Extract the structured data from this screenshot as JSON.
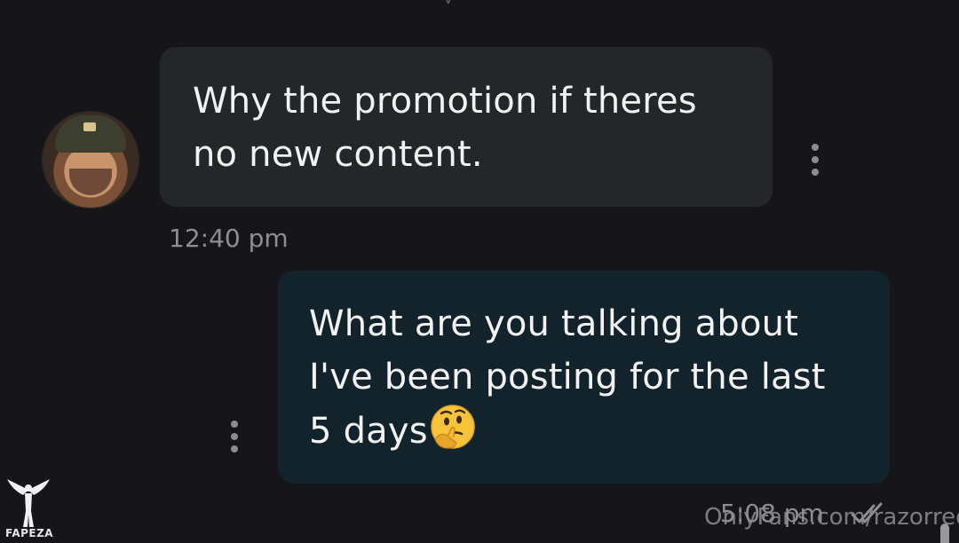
{
  "top_fragment": "y",
  "incoming": {
    "lines": [
      "Why the promotion if theres",
      "no new content."
    ],
    "time": "12:40 pm"
  },
  "outgoing": {
    "lines": [
      "What are you talking about",
      "I've been posting for the last",
      "5 days"
    ],
    "emoji": "thinking-face",
    "time": "5:08 pm",
    "status": "read-double-check"
  },
  "watermark": "OnlyFans.com/razorredd",
  "logo_text": "FAPEZA",
  "colors": {
    "background": "#161618",
    "incoming_bubble": "#252628",
    "outgoing_bubble": "#13232b",
    "meta_text": "#8e8e8e"
  },
  "icons": {
    "more_options": "vertical-dots-icon",
    "read_receipt": "double-check-icon",
    "emoji": "thinking-face-emoji"
  }
}
